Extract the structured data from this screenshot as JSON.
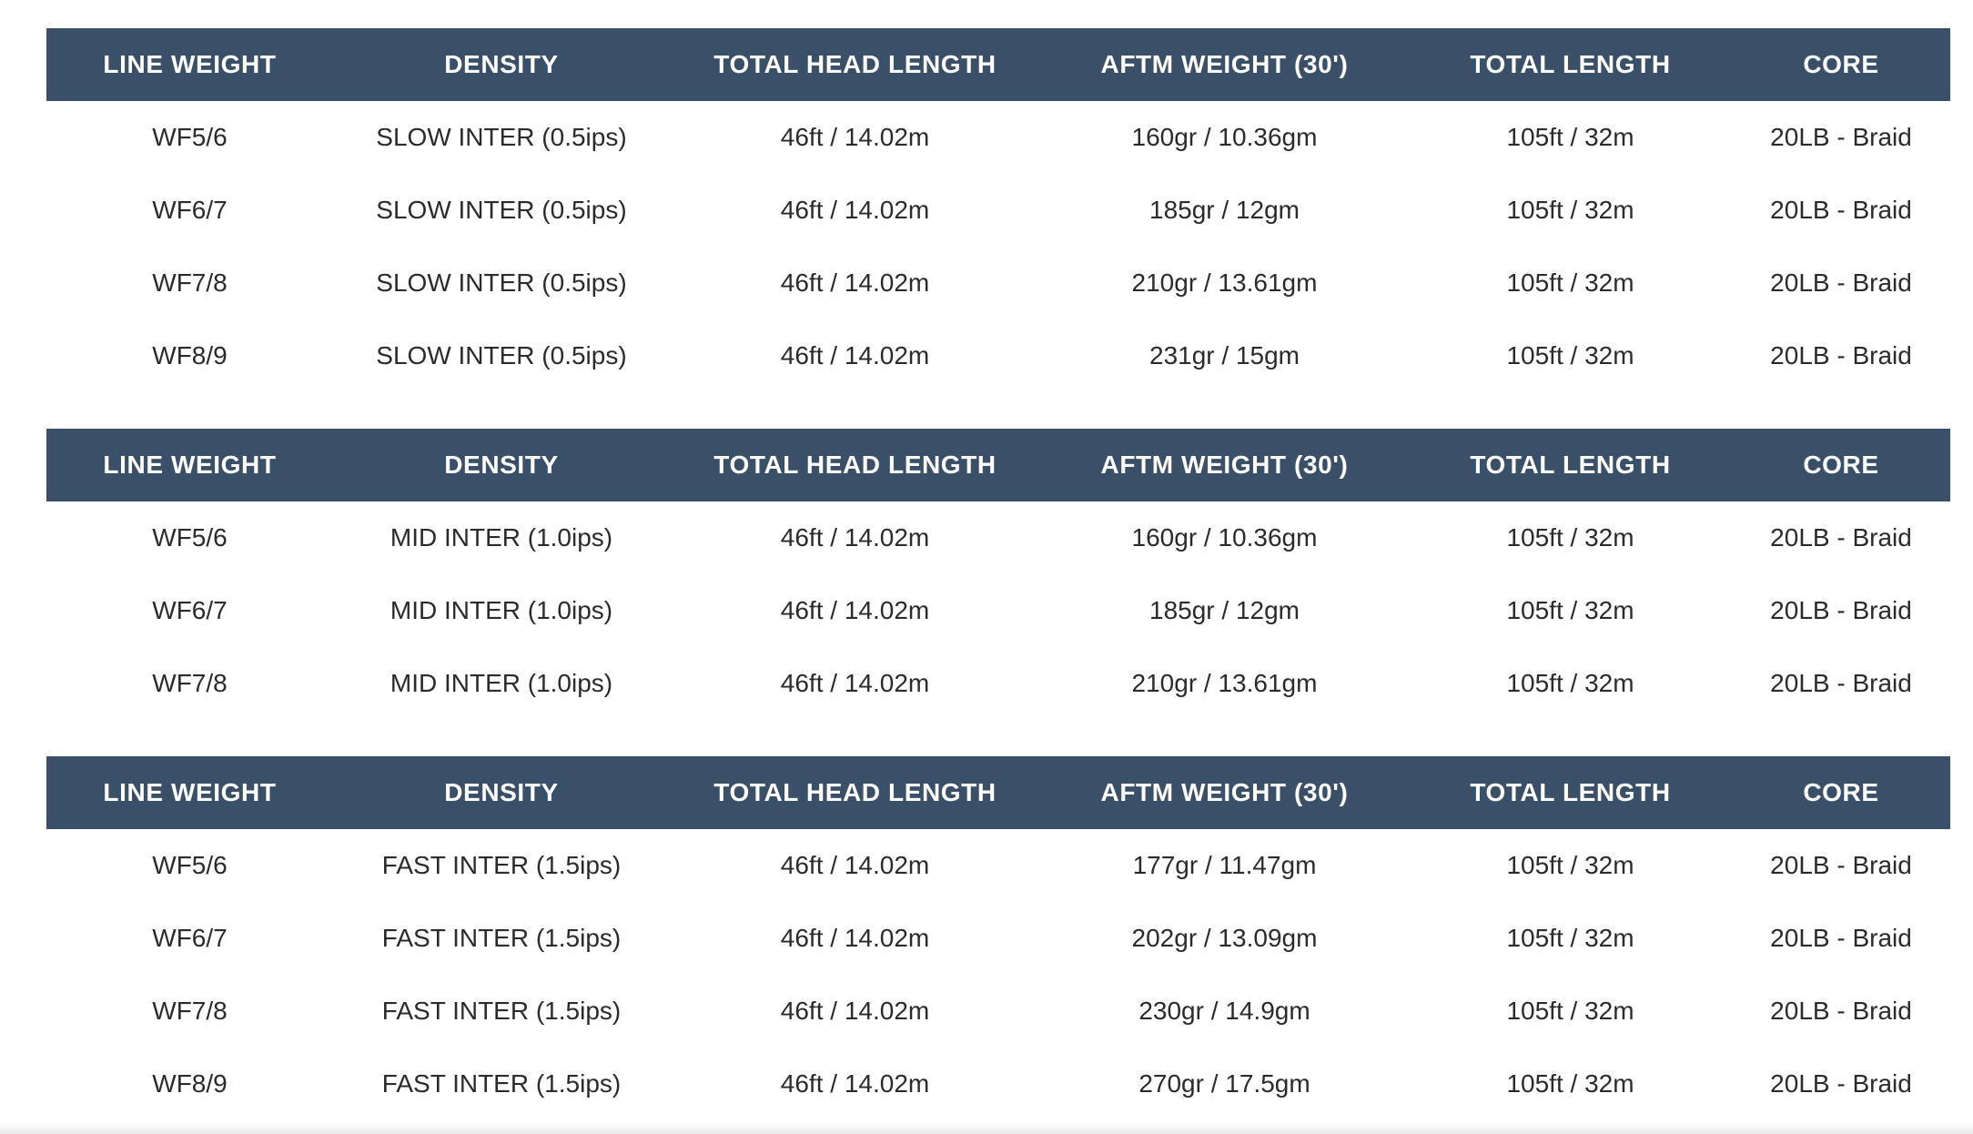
{
  "headers": {
    "line_weight": "LINE WEIGHT",
    "density": "DENSITY",
    "total_head_length": "TOTAL HEAD LENGTH",
    "aftm_weight": "AFTM WEIGHT (30')",
    "total_length": "TOTAL LENGTH",
    "core": "CORE"
  },
  "colors": {
    "header_background": "#3a5068",
    "header_text": "#ffffff",
    "body_text": "#2b2b2b"
  },
  "tables": [
    {
      "rows": [
        [
          "WF5/6",
          "SLOW INTER (0.5ips)",
          "46ft / 14.02m",
          "160gr / 10.36gm",
          "105ft / 32m",
          "20LB - Braid"
        ],
        [
          "WF6/7",
          "SLOW INTER (0.5ips)",
          "46ft / 14.02m",
          "185gr / 12gm",
          "105ft / 32m",
          "20LB - Braid"
        ],
        [
          "WF7/8",
          "SLOW INTER (0.5ips)",
          "46ft / 14.02m",
          "210gr / 13.61gm",
          "105ft / 32m",
          "20LB - Braid"
        ],
        [
          "WF8/9",
          "SLOW INTER (0.5ips)",
          "46ft / 14.02m",
          "231gr / 15gm",
          "105ft / 32m",
          "20LB - Braid"
        ]
      ]
    },
    {
      "rows": [
        [
          "WF5/6",
          "MID INTER (1.0ips)",
          "46ft / 14.02m",
          "160gr / 10.36gm",
          "105ft / 32m",
          "20LB - Braid"
        ],
        [
          "WF6/7",
          "MID INTER (1.0ips)",
          "46ft / 14.02m",
          "185gr / 12gm",
          "105ft / 32m",
          "20LB - Braid"
        ],
        [
          "WF7/8",
          "MID INTER (1.0ips)",
          "46ft / 14.02m",
          "210gr / 13.61gm",
          "105ft / 32m",
          "20LB - Braid"
        ]
      ]
    },
    {
      "rows": [
        [
          "WF5/6",
          "FAST INTER (1.5ips)",
          "46ft / 14.02m",
          "177gr / 11.47gm",
          "105ft / 32m",
          "20LB - Braid"
        ],
        [
          "WF6/7",
          "FAST INTER (1.5ips)",
          "46ft / 14.02m",
          "202gr / 13.09gm",
          "105ft / 32m",
          "20LB - Braid"
        ],
        [
          "WF7/8",
          "FAST INTER (1.5ips)",
          "46ft / 14.02m",
          "230gr / 14.9gm",
          "105ft / 32m",
          "20LB - Braid"
        ],
        [
          "WF8/9",
          "FAST INTER (1.5ips)",
          "46ft / 14.02m",
          "270gr / 17.5gm",
          "105ft / 32m",
          "20LB - Braid"
        ]
      ]
    }
  ]
}
